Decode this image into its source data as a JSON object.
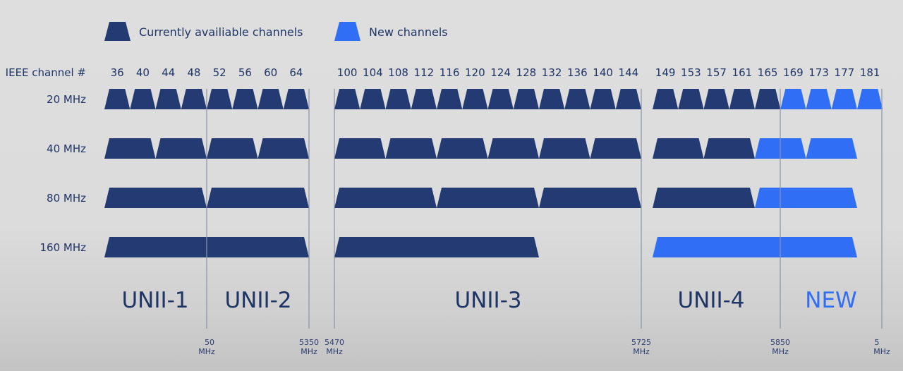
{
  "legend": [
    {
      "label": "Currently availiable channels",
      "color": "#243a72"
    },
    {
      "label": "New channels",
      "color": "#2f6ef5"
    }
  ],
  "colors": {
    "current": "#243a72",
    "new": "#2f6ef5",
    "band_current_text": "#1f3566",
    "band_new_text": "#2f6ef5"
  },
  "axis_title": "IEEE channel #",
  "channel_groups": [
    {
      "channels": [
        36,
        40,
        44,
        48,
        52,
        56,
        60,
        64
      ]
    },
    {
      "channels": [
        100,
        104,
        108,
        112,
        116,
        120,
        124,
        128,
        132,
        136,
        140,
        144
      ]
    },
    {
      "channels": [
        149,
        153,
        157,
        161,
        165,
        169,
        173,
        177,
        181
      ]
    }
  ],
  "rows": [
    {
      "label": "20 MHz",
      "channels": [
        {
          "group": 0,
          "start": 0,
          "span": 1,
          "type": "current"
        },
        {
          "group": 0,
          "start": 1,
          "span": 1,
          "type": "current"
        },
        {
          "group": 0,
          "start": 2,
          "span": 1,
          "type": "current"
        },
        {
          "group": 0,
          "start": 3,
          "span": 1,
          "type": "current"
        },
        {
          "group": 0,
          "start": 4,
          "span": 1,
          "type": "current"
        },
        {
          "group": 0,
          "start": 5,
          "span": 1,
          "type": "current"
        },
        {
          "group": 0,
          "start": 6,
          "span": 1,
          "type": "current"
        },
        {
          "group": 0,
          "start": 7,
          "span": 1,
          "type": "current"
        },
        {
          "group": 1,
          "start": 0,
          "span": 1,
          "type": "current"
        },
        {
          "group": 1,
          "start": 1,
          "span": 1,
          "type": "current"
        },
        {
          "group": 1,
          "start": 2,
          "span": 1,
          "type": "current"
        },
        {
          "group": 1,
          "start": 3,
          "span": 1,
          "type": "current"
        },
        {
          "group": 1,
          "start": 4,
          "span": 1,
          "type": "current"
        },
        {
          "group": 1,
          "start": 5,
          "span": 1,
          "type": "current"
        },
        {
          "group": 1,
          "start": 6,
          "span": 1,
          "type": "current"
        },
        {
          "group": 1,
          "start": 7,
          "span": 1,
          "type": "current"
        },
        {
          "group": 1,
          "start": 8,
          "span": 1,
          "type": "current"
        },
        {
          "group": 1,
          "start": 9,
          "span": 1,
          "type": "current"
        },
        {
          "group": 1,
          "start": 10,
          "span": 1,
          "type": "current"
        },
        {
          "group": 1,
          "start": 11,
          "span": 1,
          "type": "current"
        },
        {
          "group": 2,
          "start": 0,
          "span": 1,
          "type": "current"
        },
        {
          "group": 2,
          "start": 1,
          "span": 1,
          "type": "current"
        },
        {
          "group": 2,
          "start": 2,
          "span": 1,
          "type": "current"
        },
        {
          "group": 2,
          "start": 3,
          "span": 1,
          "type": "current"
        },
        {
          "group": 2,
          "start": 4,
          "span": 1,
          "type": "current"
        },
        {
          "group": 2,
          "start": 5,
          "span": 1,
          "type": "new"
        },
        {
          "group": 2,
          "start": 6,
          "span": 1,
          "type": "new"
        },
        {
          "group": 2,
          "start": 7,
          "span": 1,
          "type": "new"
        },
        {
          "group": 2,
          "start": 8,
          "span": 1,
          "type": "new"
        }
      ]
    },
    {
      "label": "40 MHz",
      "channels": [
        {
          "group": 0,
          "start": 0,
          "span": 2,
          "type": "current"
        },
        {
          "group": 0,
          "start": 2,
          "span": 2,
          "type": "current"
        },
        {
          "group": 0,
          "start": 4,
          "span": 2,
          "type": "current"
        },
        {
          "group": 0,
          "start": 6,
          "span": 2,
          "type": "current"
        },
        {
          "group": 1,
          "start": 0,
          "span": 2,
          "type": "current"
        },
        {
          "group": 1,
          "start": 2,
          "span": 2,
          "type": "current"
        },
        {
          "group": 1,
          "start": 4,
          "span": 2,
          "type": "current"
        },
        {
          "group": 1,
          "start": 6,
          "span": 2,
          "type": "current"
        },
        {
          "group": 1,
          "start": 8,
          "span": 2,
          "type": "current"
        },
        {
          "group": 1,
          "start": 10,
          "span": 2,
          "type": "current"
        },
        {
          "group": 2,
          "start": 0,
          "span": 2,
          "type": "current"
        },
        {
          "group": 2,
          "start": 2,
          "span": 2,
          "type": "current"
        },
        {
          "group": 2,
          "start": 4,
          "span": 2,
          "type": "new"
        },
        {
          "group": 2,
          "start": 6,
          "span": 2,
          "type": "new"
        }
      ]
    },
    {
      "label": "80 MHz",
      "channels": [
        {
          "group": 0,
          "start": 0,
          "span": 4,
          "type": "current"
        },
        {
          "group": 0,
          "start": 4,
          "span": 4,
          "type": "current"
        },
        {
          "group": 1,
          "start": 0,
          "span": 4,
          "type": "current"
        },
        {
          "group": 1,
          "start": 4,
          "span": 4,
          "type": "current"
        },
        {
          "group": 1,
          "start": 8,
          "span": 4,
          "type": "current"
        },
        {
          "group": 2,
          "start": 0,
          "span": 4,
          "type": "current"
        },
        {
          "group": 2,
          "start": 4,
          "span": 4,
          "type": "new"
        }
      ]
    },
    {
      "label": "160 MHz",
      "channels": [
        {
          "group": 0,
          "start": 0,
          "span": 8,
          "type": "current"
        },
        {
          "group": 1,
          "start": 0,
          "span": 8,
          "type": "current"
        },
        {
          "group": 2,
          "start": 0,
          "span": 8,
          "type": "new"
        }
      ]
    }
  ],
  "bands": [
    {
      "label": "UNII-1",
      "type": "current"
    },
    {
      "label": "UNII-2",
      "type": "current"
    },
    {
      "label": "UNII-3",
      "type": "current"
    },
    {
      "label": "UNII-4",
      "type": "current"
    },
    {
      "label": "NEW",
      "type": "new"
    }
  ],
  "frequency_markers": [
    {
      "value": "50",
      "unit": "MHz",
      "note": "partially obscured"
    },
    {
      "value": "5350",
      "unit": "MHz"
    },
    {
      "value": "5470",
      "unit": "MHz"
    },
    {
      "value": "5725",
      "unit": "MHz"
    },
    {
      "value": "5850",
      "unit": "MHz"
    },
    {
      "value": "5",
      "unit": "MHz",
      "note": "partially obscured"
    }
  ]
}
